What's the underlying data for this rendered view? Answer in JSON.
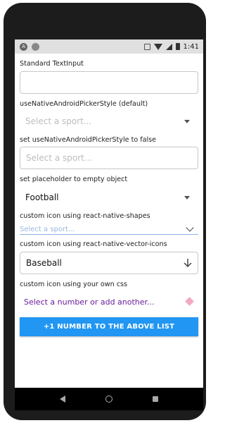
{
  "statusbar": {
    "time": "1:41"
  },
  "sections": {
    "standard": {
      "label": "Standard TextInput",
      "value": ""
    },
    "native_default": {
      "label": "useNativeAndroidPickerStyle (default)",
      "placeholder": "Select a sport..."
    },
    "native_false": {
      "label": "set useNativeAndroidPickerStyle to false",
      "placeholder": "Select a sport..."
    },
    "empty_placeholder": {
      "label": "set placeholder to empty object",
      "value": "Football"
    },
    "shapes_icon": {
      "label": "custom icon using react-native-shapes",
      "placeholder": "Select a sport..."
    },
    "vector_icons": {
      "label": "custom icon using react-native-vector-icons",
      "value": "Baseball"
    },
    "own_css": {
      "label": "custom icon using your own css",
      "placeholder": "Select a number or add another..."
    }
  },
  "button": {
    "label": "+1 NUMBER TO THE ABOVE LIST"
  },
  "colors": {
    "accent": "#2196f3",
    "purple_text": "#6a1b9a",
    "pink_icon": "#f4a8c4",
    "underline": "#8ab4e8"
  },
  "icons": [
    "android-notification-icon",
    "sd-card-icon",
    "wifi-icon",
    "signal-icon",
    "battery-icon",
    "back-icon",
    "home-icon",
    "recents-icon"
  ]
}
